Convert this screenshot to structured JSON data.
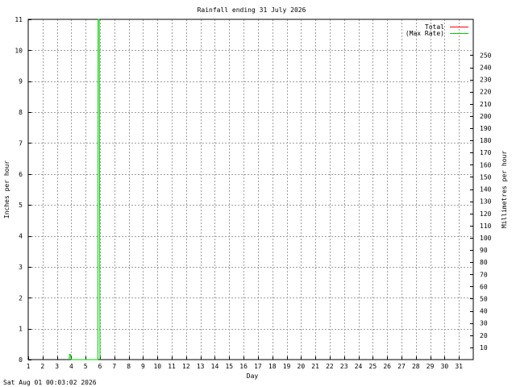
{
  "chart_data": {
    "type": "line",
    "title": "Rainfall ending 31 July 2026",
    "xlabel": "Day",
    "ylabel_left": "Inches per hour",
    "ylabel_right": "Millimetres per hour",
    "timestamp": "Sat Aug 01 00:03:02 2026",
    "x_ticks": [
      "1",
      "2",
      "3",
      "4",
      "5",
      "6",
      "7",
      "8",
      "9",
      "10",
      "11",
      "12",
      "13",
      "14",
      "15",
      "16",
      "17",
      "18",
      "19",
      "20",
      "21",
      "22",
      "23",
      "24",
      "25",
      "26",
      "27",
      "28",
      "29",
      "30",
      "31"
    ],
    "xlim": [
      1,
      32
    ],
    "ylim_left": [
      0,
      11
    ],
    "y_ticks_left": [
      "0",
      "1",
      "2",
      "3",
      "4",
      "5",
      "6",
      "7",
      "8",
      "9",
      "10",
      "11"
    ],
    "y_ticks_right": [
      "10",
      "20",
      "30",
      "40",
      "50",
      "60",
      "70",
      "80",
      "90",
      "100",
      "110",
      "120",
      "130",
      "140",
      "150",
      "160",
      "170",
      "180",
      "190",
      "200",
      "210",
      "220",
      "230",
      "240",
      "250"
    ],
    "grid": true,
    "legend_position": "top-right",
    "series": [
      {
        "name": "Total",
        "color": "#ff0000",
        "points": []
      },
      {
        "name": "(Max Rate)",
        "color": "#00cc00",
        "points": [
          [
            3.85,
            0
          ],
          [
            3.88,
            0.17
          ],
          [
            3.92,
            0.17
          ],
          [
            3.95,
            0.12
          ],
          [
            4.0,
            0
          ],
          [
            5.85,
            0
          ],
          [
            5.87,
            11
          ],
          [
            5.95,
            11
          ],
          [
            5.97,
            5.6
          ],
          [
            6.0,
            0
          ]
        ]
      }
    ]
  }
}
